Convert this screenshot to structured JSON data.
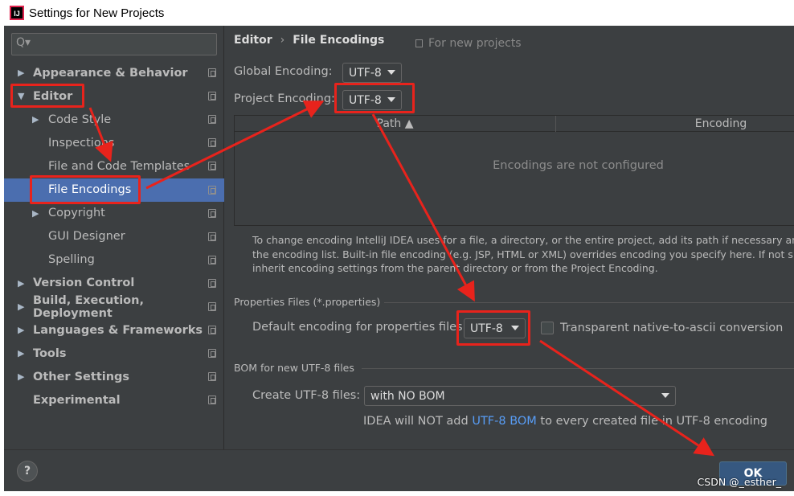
{
  "window": {
    "title": "Settings for New Projects"
  },
  "search": {
    "placeholder": "Q▾"
  },
  "sidebar": {
    "items": [
      {
        "label": "Appearance & Behavior",
        "bold": true,
        "arrow": "▶",
        "selected": false
      },
      {
        "label": "Editor",
        "bold": true,
        "arrow": "▼",
        "selected": false
      },
      {
        "label": "Code Style",
        "bold": false,
        "arrow": "▶",
        "selected": false
      },
      {
        "label": "Inspections",
        "bold": false,
        "arrow": "",
        "selected": false
      },
      {
        "label": "File and Code Templates",
        "bold": false,
        "arrow": "",
        "selected": false
      },
      {
        "label": "File Encodings",
        "bold": false,
        "arrow": "",
        "selected": true
      },
      {
        "label": "Copyright",
        "bold": false,
        "arrow": "▶",
        "selected": false
      },
      {
        "label": "GUI Designer",
        "bold": false,
        "arrow": "",
        "selected": false
      },
      {
        "label": "Spelling",
        "bold": false,
        "arrow": "",
        "selected": false
      },
      {
        "label": "Version Control",
        "bold": true,
        "arrow": "▶",
        "selected": false
      },
      {
        "label": "Build, Execution, Deployment",
        "bold": true,
        "arrow": "▶",
        "selected": false
      },
      {
        "label": "Languages & Frameworks",
        "bold": true,
        "arrow": "▶",
        "selected": false
      },
      {
        "label": "Tools",
        "bold": true,
        "arrow": "▶",
        "selected": false
      },
      {
        "label": "Other Settings",
        "bold": true,
        "arrow": "▶",
        "selected": false
      },
      {
        "label": "Experimental",
        "bold": true,
        "arrow": "",
        "selected": false
      }
    ]
  },
  "breadcrumb": {
    "parent": "Editor",
    "separator": "›",
    "current": "File Encodings",
    "scope": "For new projects"
  },
  "global_encoding": {
    "label": "Global Encoding:",
    "value": "UTF-8"
  },
  "project_encoding": {
    "label": "Project Encoding:",
    "value": "UTF-8"
  },
  "table": {
    "columns": [
      "Path ▲",
      "Encoding"
    ],
    "empty_text": "Encodings are not configured"
  },
  "help_text": [
    "To change encoding IntelliJ IDEA uses for a file, a directory, or the entire project, add its path if necessary and",
    "the encoding list. Built-in file encoding (e.g. JSP, HTML or XML) overrides encoding you specify here. If not sp",
    "inherit encoding settings from the parent directory or from the Project Encoding."
  ],
  "properties": {
    "section_title": "Properties Files (*.properties)",
    "default_label": "Default encoding for properties files:",
    "default_value": "UTF-8",
    "native_to_ascii_label": "Transparent native-to-ascii conversion",
    "native_to_ascii_checked": false
  },
  "bom": {
    "section_title": "BOM for new UTF-8 files",
    "create_label": "Create UTF-8 files:",
    "create_value": "with NO BOM",
    "info_prefix": "IDEA will NOT add ",
    "info_link": "UTF-8 BOM",
    "info_suffix": " to every created file in UTF-8 encoding"
  },
  "footer": {
    "help_label": "?",
    "ok_label": "OK"
  },
  "watermark": "CSDN @_esther_",
  "colors": {
    "background": "#3c3f41",
    "selection": "#4b6eaf",
    "link": "#589df6",
    "annotation": "#e8231c",
    "ok_button": "#365880"
  },
  "icons": [
    "intellij-app-icon",
    "search-icon",
    "copy-scope-icon",
    "help-icon",
    "chevron-down-icon"
  ]
}
